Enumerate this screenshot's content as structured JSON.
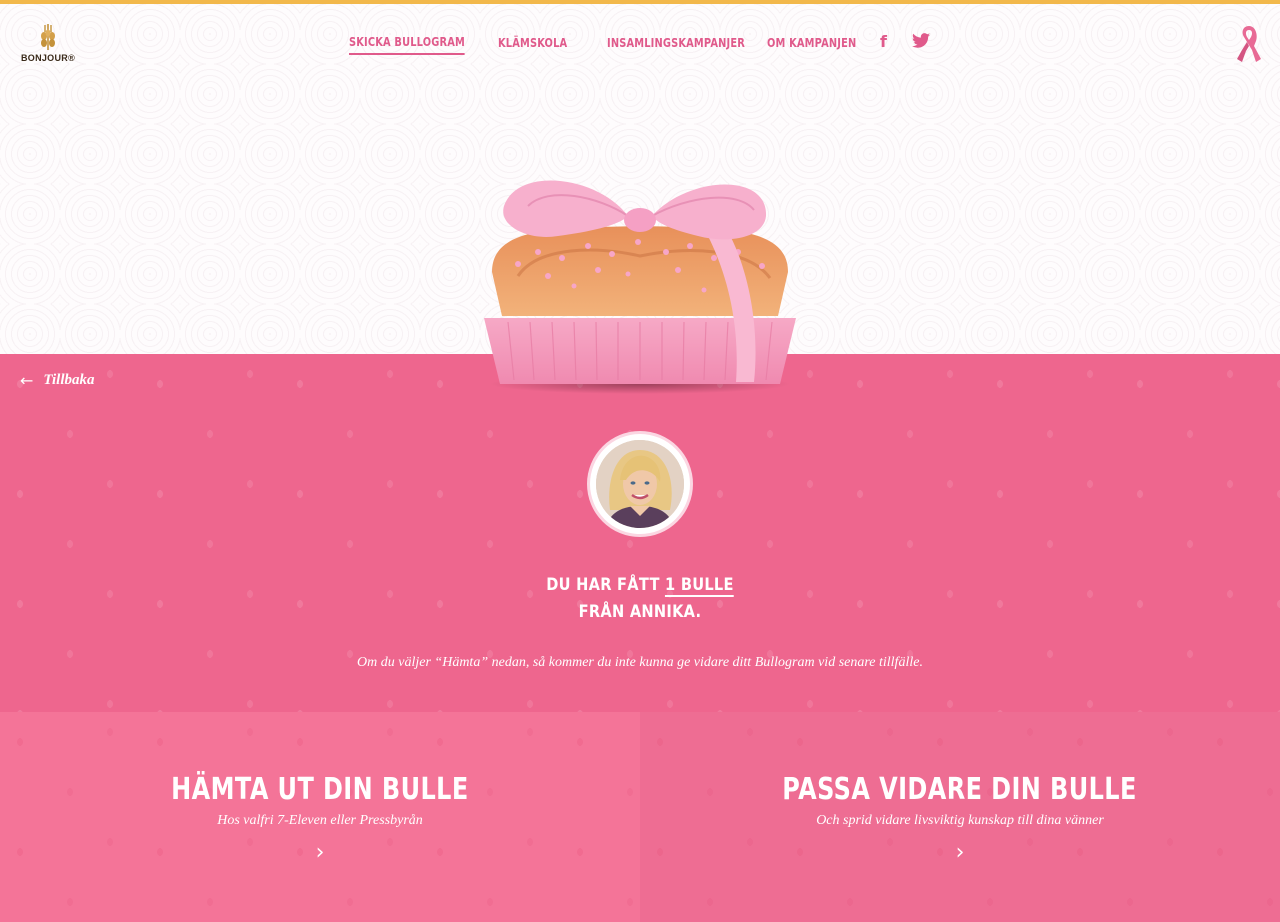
{
  "brand": {
    "logo_text": "BONJOUR®",
    "accent_color": "#e05a8b",
    "top_border_color": "#f2b84b"
  },
  "nav": {
    "items": [
      {
        "label": "SKICKA BULLOGRAM",
        "active": true
      },
      {
        "label": "KLÄMSKOLA",
        "active": false
      },
      {
        "label": "INSAMLINGSKAMPANJER",
        "active": false
      },
      {
        "label": "OM KAMPANJEN",
        "active": false
      }
    ],
    "social": {
      "facebook_glyph": "f",
      "twitter_icon": "twitter-icon"
    }
  },
  "back": {
    "label": "Tillbaka",
    "icon": "arrow-left-icon"
  },
  "message": {
    "line1_prefix": "DU HAR FÅTT ",
    "line1_link": "1 BULLE",
    "line2": "FRÅN ANNIKA.",
    "note": "Om du väljer “Hämta” nedan, så kommer du inte kunna ge vidare ditt Bullogram vid senare tillfälle."
  },
  "cards": {
    "left": {
      "title": "HÄMTA UT DIN BULLE",
      "subtitle": "Hos valfri 7-Eleven eller Pressbyrån",
      "chevron": "›"
    },
    "right": {
      "title": "PASSA VIDARE DIN BULLE",
      "subtitle": "Och sprid vidare livsviktig kunskap till dina vänner",
      "chevron": "›"
    }
  },
  "colors": {
    "pink_section": "#ee668e",
    "card_left": "#f47498",
    "card_right": "#ee6d93"
  }
}
